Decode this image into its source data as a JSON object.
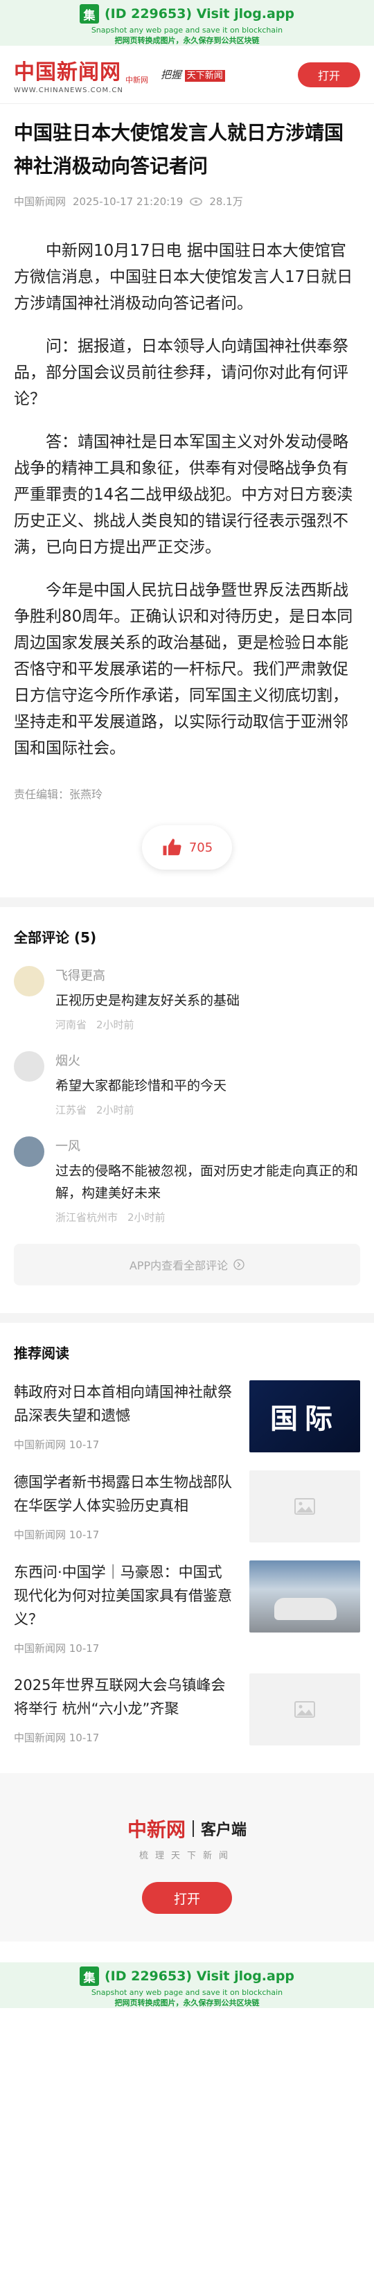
{
  "banner": {
    "icon_char": "集",
    "title": "(ID 229653) Visit jlog.app",
    "line2": "Snapshot any web page and save it on blockchain",
    "line3": "把网页转换成图片，永久保存到公共区块链"
  },
  "header": {
    "brand_cn": "中国新闻网",
    "brand_sub": "中新网",
    "brand_url": "WWW.CHINANEWS.COM.CN",
    "slogan_a": "把握",
    "slogan_b": "天下新闻",
    "open_label": "打开"
  },
  "article": {
    "title": "中国驻日本大使馆发言人就日方涉靖国神社消极动向答记者问",
    "source": "中国新闻网",
    "datetime": "2025-10-17 21:20:19",
    "views": "28.1万",
    "paragraphs": [
      "中新网10月17日电 据中国驻日本大使馆官方微信消息，中国驻日本大使馆发言人17日就日方涉靖国神社消极动向答记者问。",
      "问：据报道，日本领导人向靖国神社供奉祭品，部分国会议员前往参拜，请问你对此有何评论？",
      "答：靖国神社是日本军国主义对外发动侵略战争的精神工具和象征，供奉有对侵略战争负有严重罪责的14名二战甲级战犯。中方对日方亵渎历史正义、挑战人类良知的错误行径表示强烈不满，已向日方提出严正交涉。",
      "今年是中国人民抗日战争暨世界反法西斯战争胜利80周年。正确认识和对待历史，是日本同周边国家发展关系的政治基础，更是检验日本能否恪守和平发展承诺的一杆标尺。我们严肃敦促日方信守迄今所作承诺，同军国主义彻底切割，坚持走和平发展道路，以实际行动取信于亚洲邻国和国际社会。"
    ],
    "editor": "责任编辑：张燕玲",
    "likes": "705"
  },
  "comments": {
    "title": "全部评论 (5)",
    "items": [
      {
        "name": "飞得更高",
        "text": "正视历史是构建友好关系的基础",
        "location": "河南省",
        "time": "2小时前",
        "avatar_color": "#f0e6c8"
      },
      {
        "name": "烟火",
        "text": "希望大家都能珍惜和平的今天",
        "location": "江苏省",
        "time": "2小时前",
        "avatar_color": "#e4e4e4"
      },
      {
        "name": "一风",
        "text": "过去的侵略不能被忽视，面对历史才能走向真正的和解，构建美好未来",
        "location": "浙江省杭州市",
        "time": "2小时前",
        "avatar_color": "#7f94a8"
      }
    ],
    "more_label": "APP内查看全部评论"
  },
  "recommend": {
    "title": "推荐阅读",
    "items": [
      {
        "title": "韩政府对日本首相向靖国神社献祭品深表失望和遗憾",
        "meta": "中国新闻网 10-17",
        "img": "国际"
      },
      {
        "title": "德国学者新书揭露日本生物战部队在华医学人体实验历史真相",
        "meta": "中国新闻网 10-17",
        "img": ""
      },
      {
        "title": "东西问·中国学｜马豪恩：中国式现代化为何对拉美国家具有借鉴意义？",
        "meta": "中国新闻网 10-17",
        "img": ""
      },
      {
        "title": "2025年世界互联网大会乌镇峰会将举行 杭州“六小龙”齐聚",
        "meta": "中国新闻网 10-17",
        "img": ""
      }
    ]
  },
  "footer": {
    "brand_cn": "中新网",
    "client": "客户端",
    "tagline": "梳理天下新闻",
    "open_label": "打开"
  }
}
